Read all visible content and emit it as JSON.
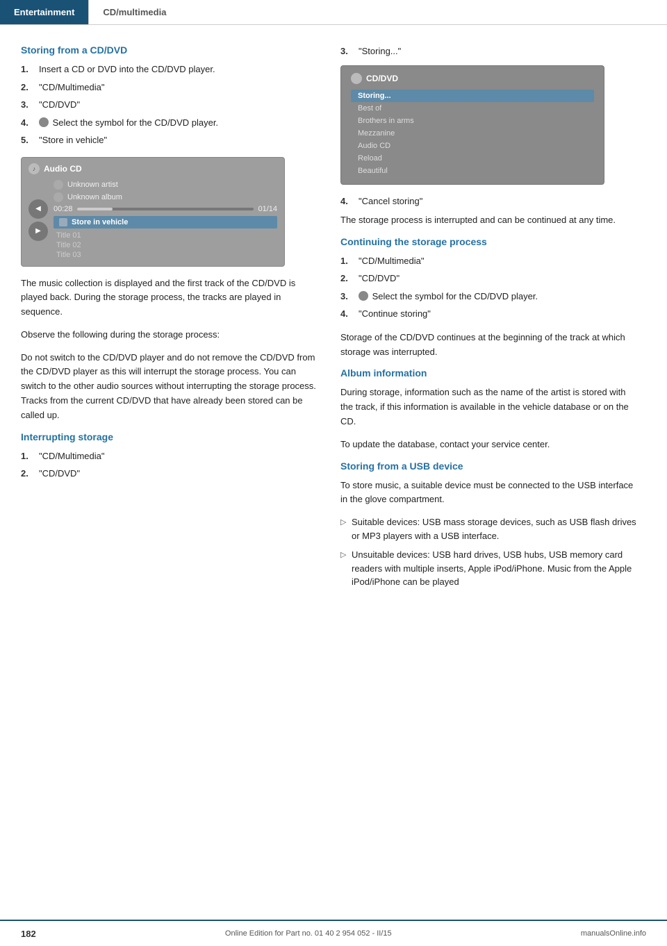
{
  "header": {
    "tab1": "Entertainment",
    "tab2": "CD/multimedia"
  },
  "left": {
    "section1_heading": "Storing from a CD/DVD",
    "steps1": [
      {
        "num": "1.",
        "text": "Insert a CD or DVD into the CD/DVD player."
      },
      {
        "num": "2.",
        "text": "\"CD/Multimedia\""
      },
      {
        "num": "3.",
        "text": "\"CD/DVD\""
      },
      {
        "num": "4.",
        "text": "Select the symbol for the CD/DVD player.",
        "has_icon": true
      },
      {
        "num": "5.",
        "text": "\"Store in vehicle\""
      }
    ],
    "screenshot1": {
      "header": "Audio CD",
      "artist": "Unknown artist",
      "album": "Unknown album",
      "time": "00:28",
      "track": "01/14",
      "store_label": "Store in vehicle",
      "titles": [
        "Title   01",
        "Title   02",
        "Title   03"
      ]
    },
    "body1": "The music collection is displayed and the first track of the CD/DVD is played back. During the storage process, the tracks are played in sequence.",
    "body2": "Observe the following during the storage process:",
    "body3": "Do not switch to the CD/DVD player and do not remove the CD/DVD from the CD/DVD player as this will interrupt the storage process. You can switch to the other audio sources without interrupting the storage process. Tracks from the current CD/DVD that have already been stored can be called up.",
    "section2_heading": "Interrupting storage",
    "steps2": [
      {
        "num": "1.",
        "text": "\"CD/Multimedia\""
      },
      {
        "num": "2.",
        "text": "\"CD/DVD\""
      }
    ]
  },
  "right": {
    "step3_label": "3.",
    "step3_text": "\"Storing...\"",
    "screenshot2": {
      "header": "CD/DVD",
      "items": [
        {
          "text": "Storing...",
          "highlighted": true
        },
        {
          "text": "Best of",
          "highlighted": false
        },
        {
          "text": "Brothers in arms",
          "highlighted": false
        },
        {
          "text": "Mezzanine",
          "highlighted": false
        },
        {
          "text": "Audio CD",
          "highlighted": false
        },
        {
          "text": "Reload",
          "highlighted": false
        },
        {
          "text": "Beautiful",
          "highlighted": false
        }
      ]
    },
    "step4_label": "4.",
    "step4_text": "\"Cancel storing\"",
    "body_cancel": "The storage process is interrupted and can be continued at any time.",
    "section3_heading": "Continuing the storage process",
    "steps3": [
      {
        "num": "1.",
        "text": "\"CD/Multimedia\""
      },
      {
        "num": "2.",
        "text": "\"CD/DVD\""
      },
      {
        "num": "3.",
        "text": "Select the symbol for the CD/DVD player.",
        "has_icon": true
      },
      {
        "num": "4.",
        "text": "\"Continue storing\""
      }
    ],
    "body_continue": "Storage of the CD/DVD continues at the beginning of the track at which storage was interrupted.",
    "section4_heading": "Album information",
    "body_album": "During storage, information such as the name of the artist is stored with the track, if this information is available in the vehicle database or on the CD.",
    "body_update": "To update the database, contact your service center.",
    "section5_heading": "Storing from a USB device",
    "body_usb": "To store music, a suitable device must be connected to the USB interface in the glove compartment.",
    "bullets": [
      "Suitable devices: USB mass storage devices, such as USB flash drives or MP3 players with a USB interface.",
      "Unsuitable devices: USB hard drives, USB hubs, USB memory card readers with multiple inserts, Apple iPod/iPhone. Music from the Apple iPod/iPhone can be played"
    ]
  },
  "footer": {
    "page_num": "182",
    "copyright": "Online Edition for Part no. 01 40 2 954 052 - II/15",
    "site": "manualsOnline.info"
  }
}
